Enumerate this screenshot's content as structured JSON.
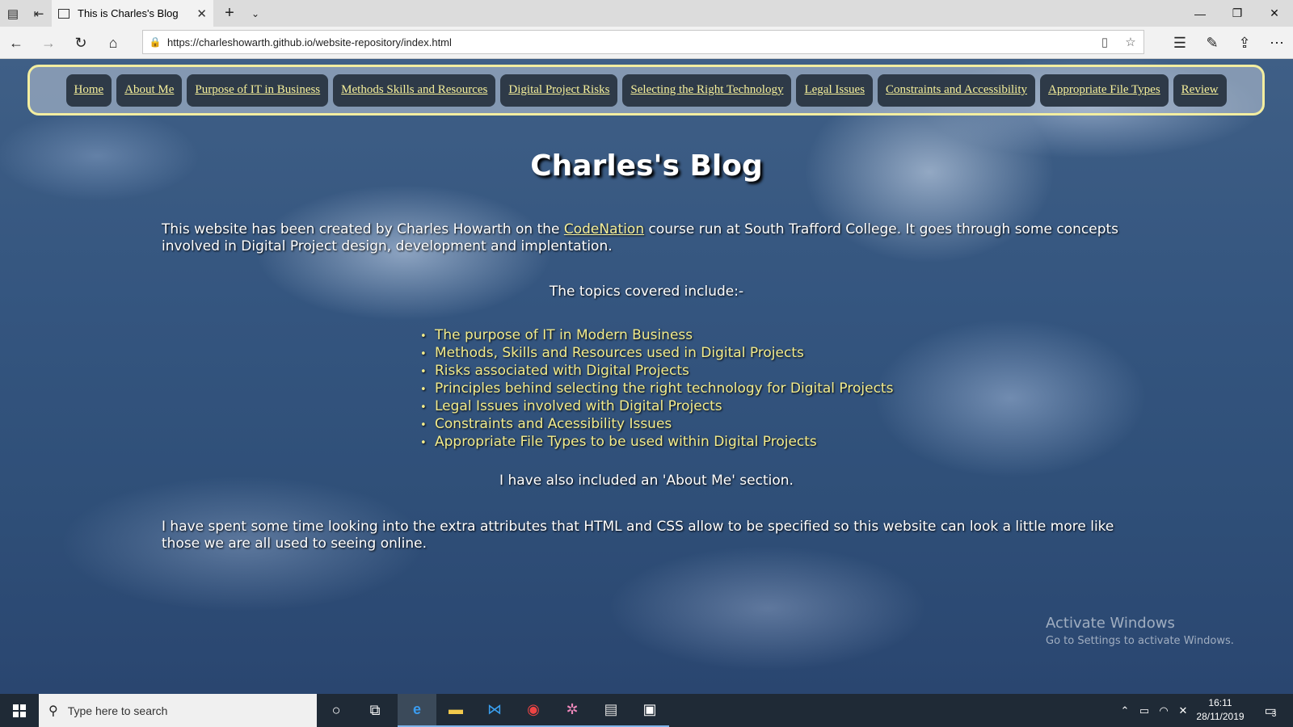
{
  "browser": {
    "tab_title": "This is Charles's Blog",
    "url": "https://charleshowarth.github.io/website-repository/index.html"
  },
  "nav": {
    "items": [
      "Home",
      "About Me",
      "Purpose of IT in Business",
      "Methods Skills and Resources",
      "Digital Project Risks",
      "Selecting the Right Technology",
      "Legal Issues",
      "Constraints and Accessibility",
      "Appropriate File Types",
      "Review"
    ]
  },
  "page": {
    "title": "Charles's Blog",
    "intro_before": "This website has been created by Charles Howarth on the ",
    "intro_link": "CodeNation",
    "intro_after": " course run at South Trafford College. It goes through some concepts involved in Digital Project design, development and implentation.",
    "topics_intro": "The topics covered include:-",
    "topics": [
      "The purpose of IT in Modern Business",
      "Methods, Skills and Resources used in Digital Projects",
      "Risks associated with Digital Projects",
      "Principles behind selecting the right technology for Digital Projects",
      "Legal Issues involved with Digital Projects",
      "Constraints and Acessibility Issues",
      "Appropriate File Types to be used within Digital Projects"
    ],
    "about_note": "I have also included an 'About Me' section.",
    "outro": "I have spent some time looking into the extra attributes that HTML and CSS allow to be specified so this website can look a little more like those we are all used to seeing online."
  },
  "watermark": {
    "line1": "Activate Windows",
    "line2": "Go to Settings to activate Windows."
  },
  "taskbar": {
    "search_placeholder": "Type here to search",
    "time": "16:11",
    "date": "28/11/2019",
    "notification_count": "3"
  },
  "colors": {
    "nav_text": "#f5ef9a",
    "nav_border": "#f3eea0",
    "topic_text": "#f3ec8c",
    "sky": "#34557f"
  }
}
